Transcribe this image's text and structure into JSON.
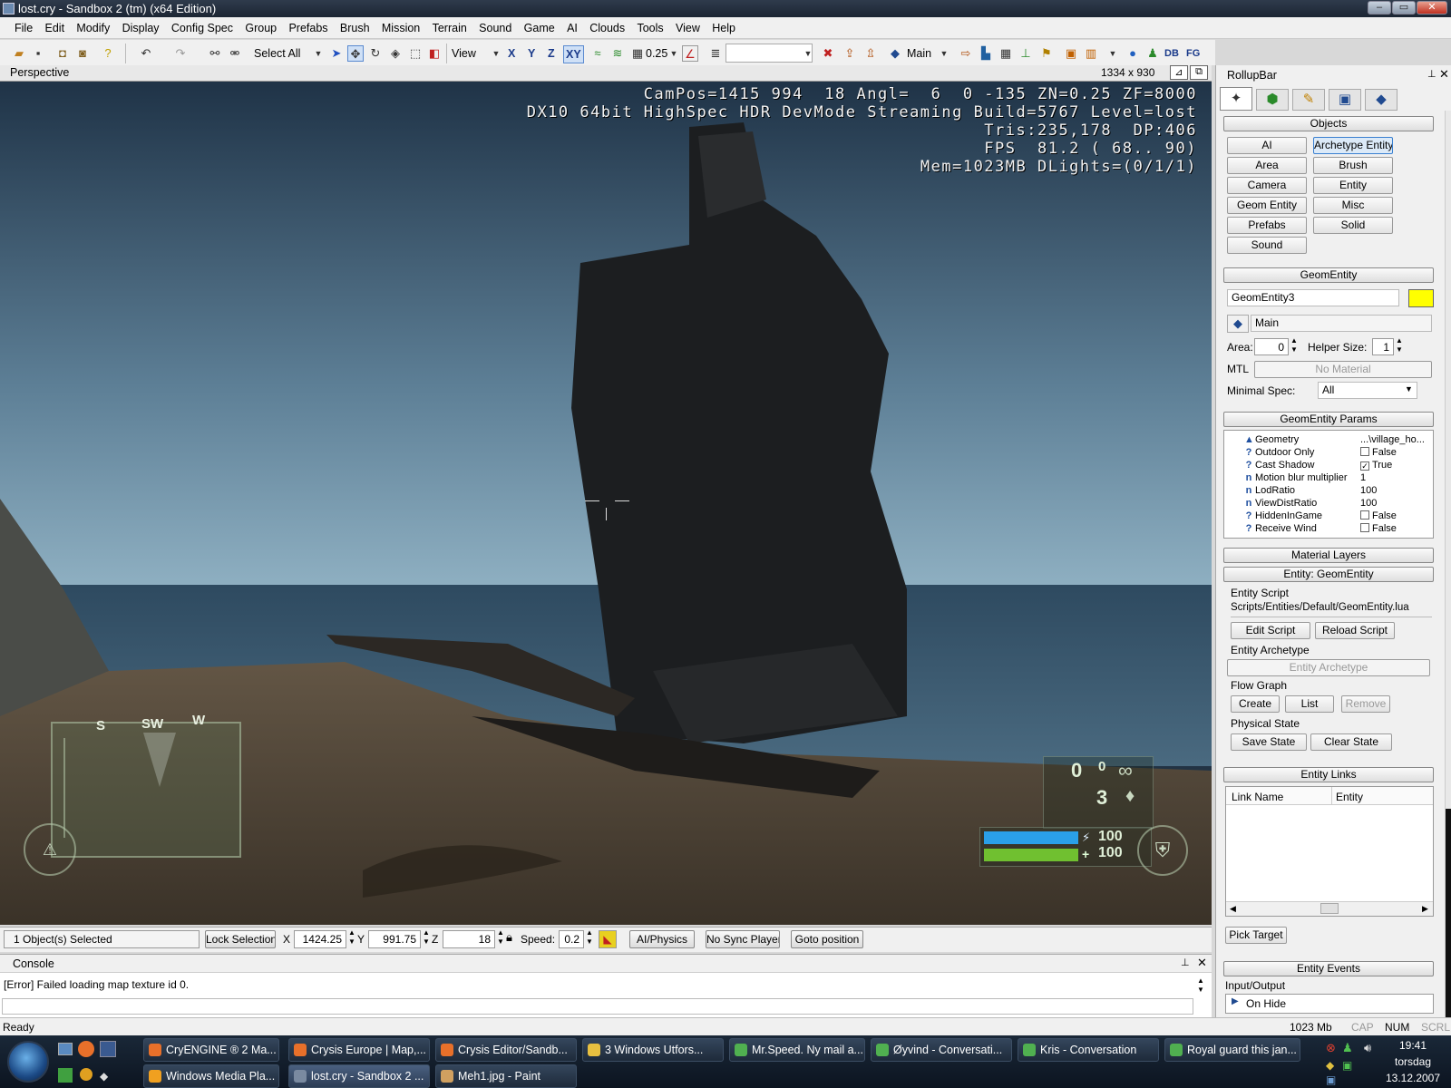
{
  "window": {
    "title": "lost.cry - Sandbox 2 (tm) (x64 Edition)",
    "controls": [
      "–",
      "▭",
      "✕"
    ]
  },
  "menu": [
    "File",
    "Edit",
    "Modify",
    "Display",
    "Config Spec",
    "Group",
    "Prefabs",
    "Brush",
    "Mission",
    "Terrain",
    "Sound",
    "Game",
    "AI",
    "Clouds",
    "Tools",
    "View",
    "Help"
  ],
  "toolbar": {
    "select_all": "Select All",
    "view": "View",
    "axis_x": "X",
    "axis_y": "Y",
    "axis_z": "Z",
    "axis_xy": "XY",
    "grid_value": "0.25",
    "layer": "Main"
  },
  "viewport": {
    "name": "Perspective",
    "resolution": "1334 x 930",
    "hud_lines": [
      "CamPos=1415 994  18 Angl=  6  0 -135 ZN=0.25 ZF=8000",
      "DX10 64bit HighSpec HDR DevMode Streaming Build=5767 Level=lost",
      "Tris:235,178  DP:406",
      "FPS  81.2 ( 68.. 90)",
      "Mem=1023MB DLights=(0/1/1)"
    ],
    "compass": [
      "S",
      "SW",
      "W"
    ],
    "ammo": "0",
    "ammo_reserve": "0",
    "grenades": "3",
    "energy": "100",
    "health": "100"
  },
  "status": {
    "selection": "1 Object(s) Selected",
    "lock_selection": "Lock Selection",
    "x_label": "X",
    "x": "1424.25",
    "y_label": "Y",
    "y": "991.75",
    "z_label": "Z",
    "z": "18",
    "speed_label": "Speed:",
    "speed": "0.2",
    "ai_physics": "AI/Physics",
    "no_sync": "No Sync Player",
    "goto": "Goto position"
  },
  "console": {
    "title": "Console",
    "message": "[Error] Failed loading map texture id 0."
  },
  "readybar": {
    "ready": "Ready",
    "memory": "1023 Mb",
    "caps": "CAP",
    "num": "NUM",
    "scrl": "SCRL"
  },
  "rollup": {
    "title": "RollupBar",
    "objects_header": "Objects",
    "object_buttons": [
      "AI",
      "Archetype Entity",
      "Area",
      "Brush",
      "Camera",
      "Entity",
      "Geom Entity",
      "Misc",
      "Prefabs",
      "Solid",
      "Sound"
    ],
    "geom_header": "GeomEntity",
    "entity_name": "GeomEntity3",
    "entity_color": "#ffff00",
    "layer": "Main",
    "area_label": "Area:",
    "area": "0",
    "helper_label": "Helper Size:",
    "helper": "1",
    "mtl_label": "MTL",
    "mtl": "No Material",
    "minspec_label": "Minimal Spec:",
    "minspec": "All",
    "params_header": "GeomEntity Params",
    "params": [
      {
        "icon": "▲",
        "name": "Geometry",
        "value": "...\\village_ho..."
      },
      {
        "icon": "?",
        "name": "Outdoor Only",
        "value": "False",
        "check": ""
      },
      {
        "icon": "?",
        "name": "Cast Shadow",
        "value": "True",
        "check": "✓"
      },
      {
        "icon": "n",
        "name": "Motion blur multiplier",
        "value": "1"
      },
      {
        "icon": "n",
        "name": "LodRatio",
        "value": "100"
      },
      {
        "icon": "n",
        "name": "ViewDistRatio",
        "value": "100"
      },
      {
        "icon": "?",
        "name": "HiddenInGame",
        "value": "False",
        "check": ""
      },
      {
        "icon": "?",
        "name": "Receive Wind",
        "value": "False",
        "check": ""
      }
    ],
    "material_layers": "Material Layers",
    "entity_header": "Entity: GeomEntity",
    "entity_script_label": "Entity Script",
    "entity_script": "Scripts/Entities/Default/GeomEntity.lua",
    "edit_script": "Edit Script",
    "reload_script": "Reload Script",
    "archetype_label": "Entity Archetype",
    "archetype": "Entity Archetype",
    "flowgraph_label": "Flow Graph",
    "create": "Create",
    "list": "List",
    "remove": "Remove",
    "physical_label": "Physical State",
    "save_state": "Save State",
    "clear_state": "Clear State",
    "links_header": "Entity Links",
    "link_col1": "Link Name",
    "link_col2": "Entity",
    "pick_target": "Pick Target",
    "events_header": "Entity Events",
    "io_label": "Input/Output",
    "on_hide": "On Hide"
  },
  "taskbar": {
    "row1": [
      {
        "label": "CryENGINE ® 2 Ma...",
        "color": "#e8702a"
      },
      {
        "label": "Crysis Europe | Map,...",
        "color": "#e8702a"
      },
      {
        "label": "Crysis Editor/Sandb...",
        "color": "#e8702a"
      },
      {
        "label": "3 Windows Utfors...",
        "color": "#e8c040"
      },
      {
        "label": "Mr.Speed. Ny mail a...",
        "color": "#50b050"
      },
      {
        "label": "Øyvind - Conversati...",
        "color": "#50b050"
      },
      {
        "label": "Kris - Conversation",
        "color": "#50b050"
      },
      {
        "label": "Royal guard this jan...",
        "color": "#50b050"
      }
    ],
    "row2": [
      {
        "label": "Windows Media Pla...",
        "color": "#f0a020"
      },
      {
        "label": "lost.cry - Sandbox 2 ...",
        "color": "#7a8aa0"
      },
      {
        "label": "Meh1.jpg - Paint",
        "color": "#d0a060"
      }
    ],
    "clock": "19:41",
    "day": "torsdag",
    "date": "13.12.2007"
  }
}
